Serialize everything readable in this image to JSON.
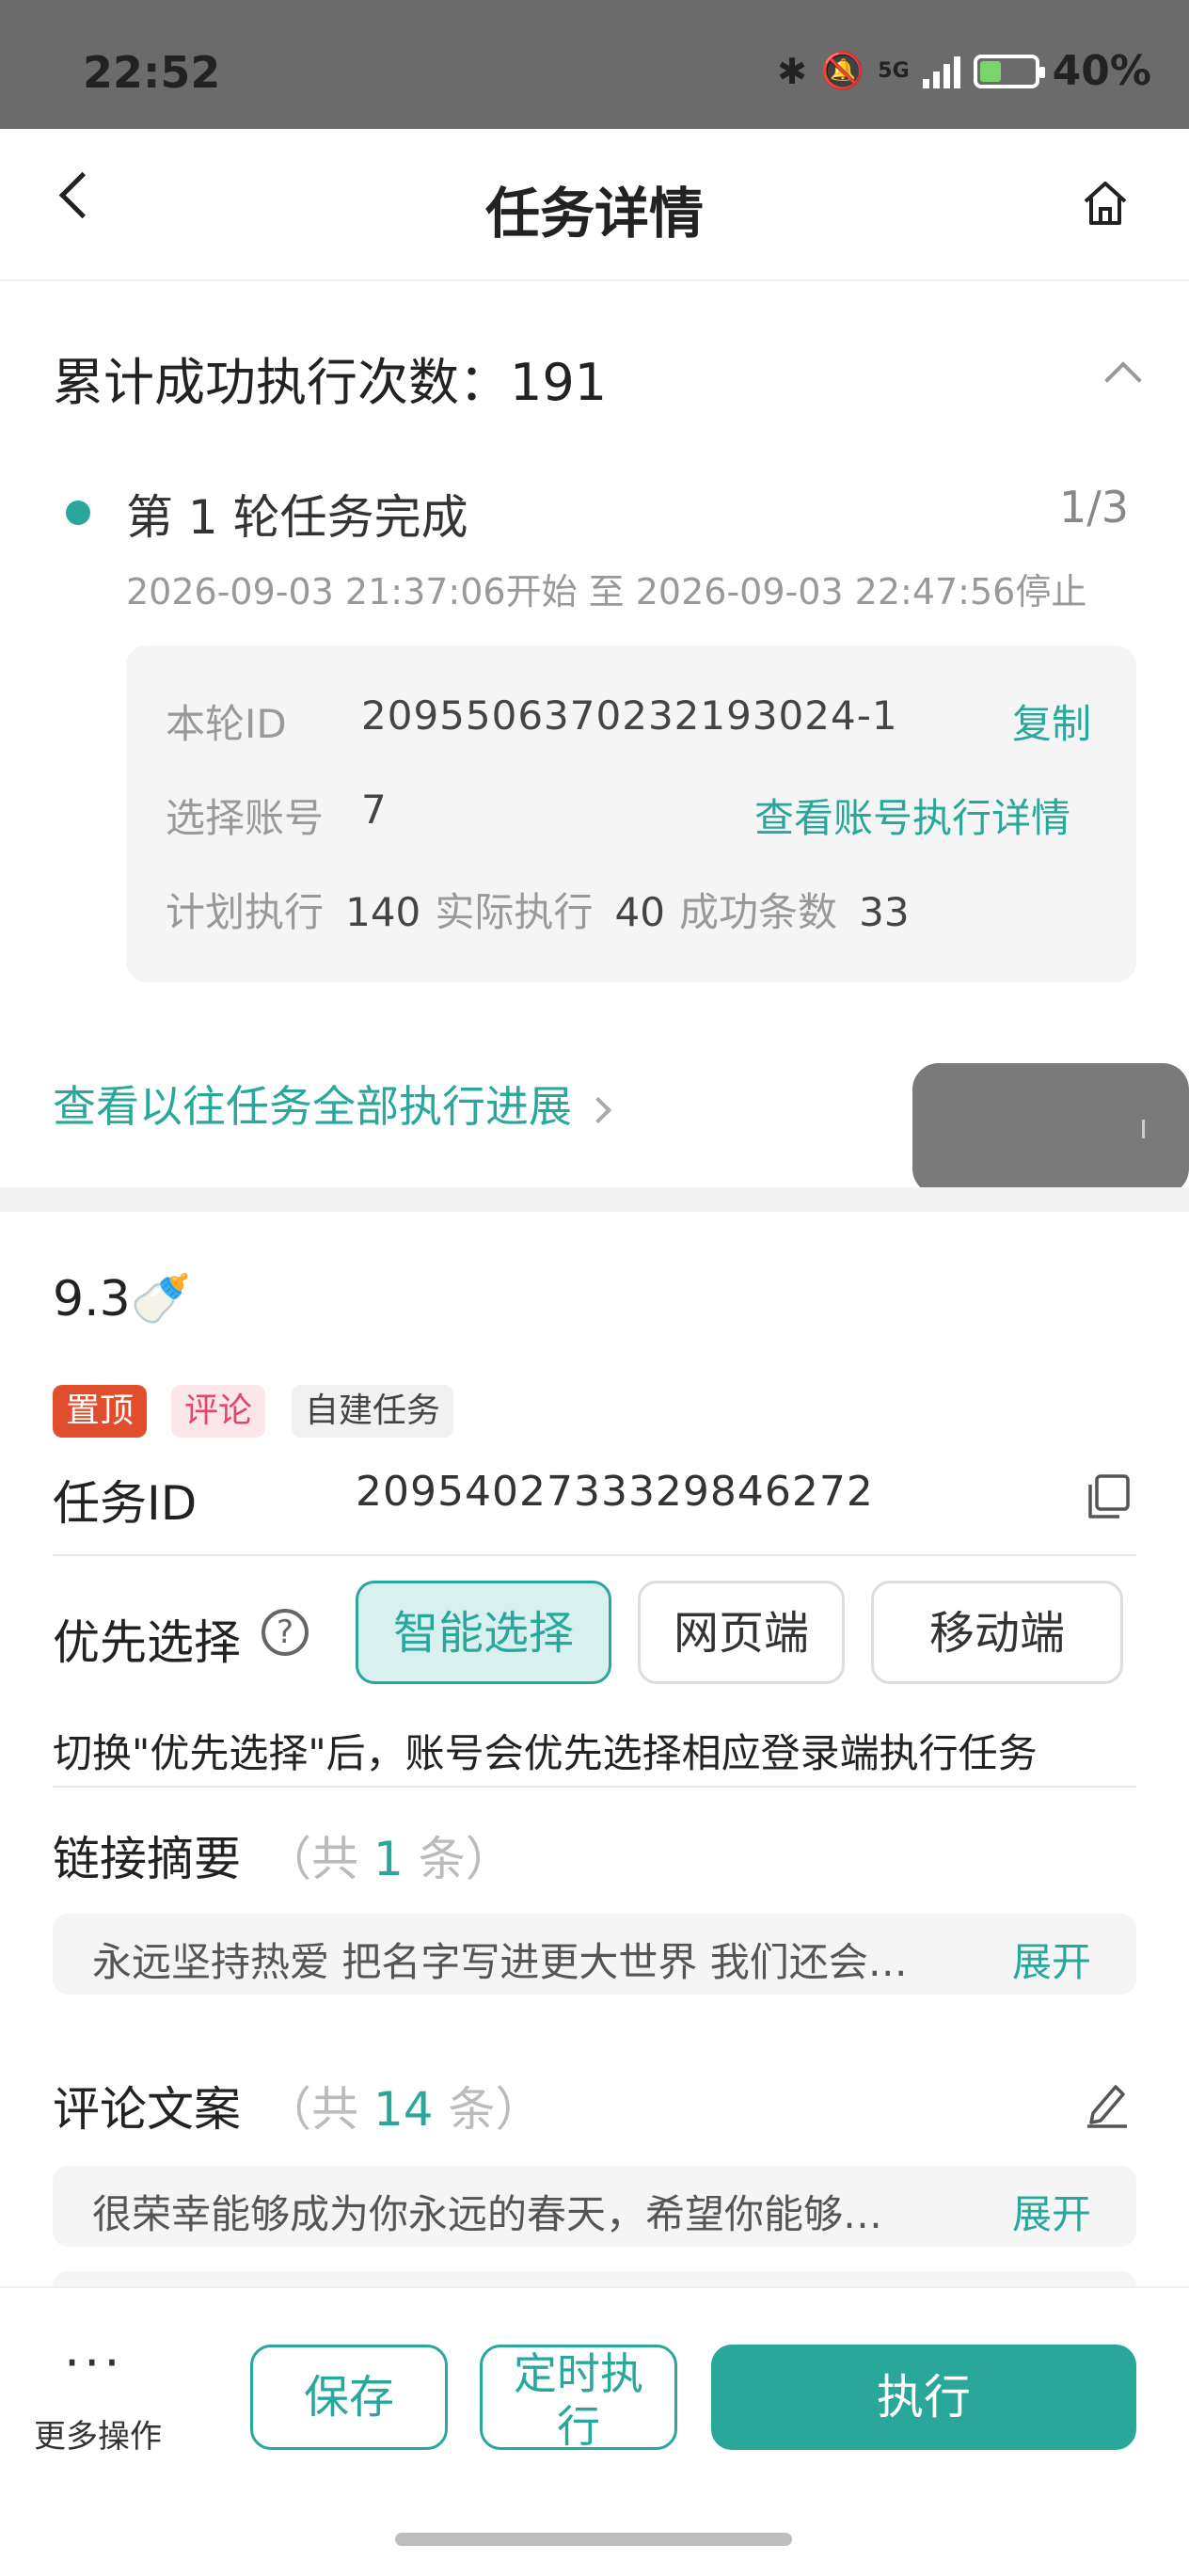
{
  "status_bar": {
    "time": "22:52",
    "network": "5G",
    "battery": "40%",
    "battery_level": 0.4
  },
  "header": {
    "title": "任务详情"
  },
  "summary": {
    "label": "累计成功执行次数：",
    "value": "191",
    "round_title": "第 1 轮任务完成",
    "round_fraction": "1/3",
    "time_range": "2026-09-03 21:37:06开始 至 2026-09-03 22:47:56停止",
    "round_id_label": "本轮ID",
    "round_id": "2095506370232193024-1",
    "copy_link": "复制",
    "account_label": "选择账号",
    "account_value": "7",
    "account_detail_link": "查看账号执行详情",
    "plan_label": "计划执行",
    "plan_value": "140",
    "actual_label": "实际执行",
    "actual_value": "40",
    "success_label": "成功条数",
    "success_value": "33",
    "history_link": "查看以往任务全部执行进展"
  },
  "task": {
    "name": "9.3🍼",
    "tags": [
      "置顶",
      "评论",
      "自建任务"
    ],
    "id_label": "任务ID",
    "id_value": "2095402733329846272",
    "priority_label": "优先选择",
    "priority_help": "?",
    "priority_options": [
      "智能选择",
      "网页端",
      "移动端"
    ],
    "priority_selected": "智能选择",
    "hint": "切换\"优先选择\"后，账号会优先选择相应登录端执行任务",
    "link_summary_label": "链接摘要",
    "link_count_prefix": "（共",
    "link_count": "1",
    "link_count_suffix": "条）",
    "link_summary_text": "永远坚持热爱 把名字写进更大世界 我们还会…",
    "comment_label": "评论文案",
    "comment_count_prefix": "（共",
    "comment_count": "14",
    "comment_count_suffix": "条）",
    "comment_text": "很荣幸能够成为你永远的春天，希望你能够…",
    "expand": "展开"
  },
  "bottom_bar": {
    "more_label": "更多操作",
    "more_dots": "···",
    "save": "保存",
    "timer_line1": "定时执",
    "timer_line2": "行",
    "execute": "执行"
  },
  "colors": {
    "accent": "#2aa79b",
    "tag_top": "#e04e2e",
    "tag_comment": "#e0476a"
  }
}
